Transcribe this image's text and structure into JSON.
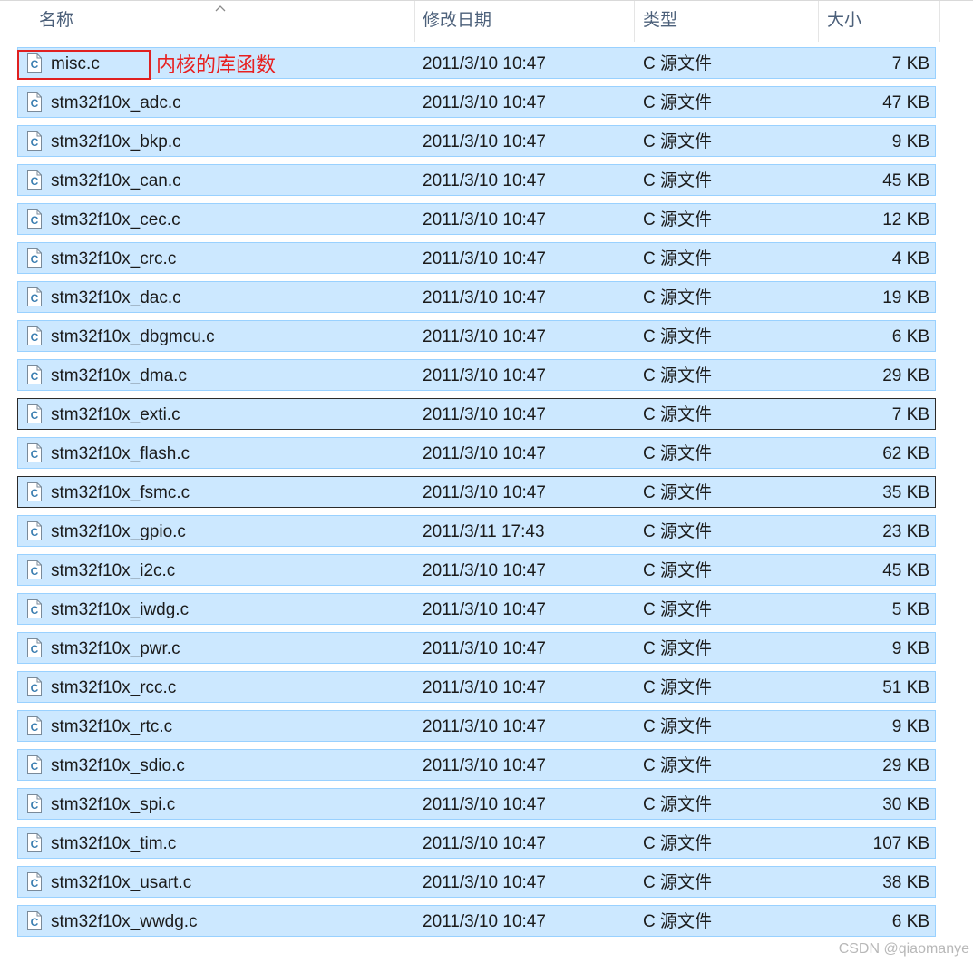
{
  "columns": {
    "name": "名称",
    "date": "修改日期",
    "type": "类型",
    "size": "大小"
  },
  "annotation": "内核的库函数",
  "watermark": "CSDN @qiaomanye",
  "icons": {
    "file": "c-source-file-icon",
    "sort": "sort-ascending-icon"
  },
  "colors": {
    "selection_bg": "#cce8ff",
    "selection_border": "#99d1ff",
    "annotation": "#e82020"
  },
  "files": [
    {
      "name": "misc.c",
      "date": "2011/3/10 10:47",
      "type": "C 源文件",
      "size": "7 KB"
    },
    {
      "name": "stm32f10x_adc.c",
      "date": "2011/3/10 10:47",
      "type": "C 源文件",
      "size": "47 KB"
    },
    {
      "name": "stm32f10x_bkp.c",
      "date": "2011/3/10 10:47",
      "type": "C 源文件",
      "size": "9 KB"
    },
    {
      "name": "stm32f10x_can.c",
      "date": "2011/3/10 10:47",
      "type": "C 源文件",
      "size": "45 KB"
    },
    {
      "name": "stm32f10x_cec.c",
      "date": "2011/3/10 10:47",
      "type": "C 源文件",
      "size": "12 KB"
    },
    {
      "name": "stm32f10x_crc.c",
      "date": "2011/3/10 10:47",
      "type": "C 源文件",
      "size": "4 KB"
    },
    {
      "name": "stm32f10x_dac.c",
      "date": "2011/3/10 10:47",
      "type": "C 源文件",
      "size": "19 KB"
    },
    {
      "name": "stm32f10x_dbgmcu.c",
      "date": "2011/3/10 10:47",
      "type": "C 源文件",
      "size": "6 KB"
    },
    {
      "name": "stm32f10x_dma.c",
      "date": "2011/3/10 10:47",
      "type": "C 源文件",
      "size": "29 KB"
    },
    {
      "name": "stm32f10x_exti.c",
      "date": "2011/3/10 10:47",
      "type": "C 源文件",
      "size": "7 KB",
      "focused": true
    },
    {
      "name": "stm32f10x_flash.c",
      "date": "2011/3/10 10:47",
      "type": "C 源文件",
      "size": "62 KB"
    },
    {
      "name": "stm32f10x_fsmc.c",
      "date": "2011/3/10 10:47",
      "type": "C 源文件",
      "size": "35 KB",
      "focused": true
    },
    {
      "name": "stm32f10x_gpio.c",
      "date": "2011/3/11 17:43",
      "type": "C 源文件",
      "size": "23 KB"
    },
    {
      "name": "stm32f10x_i2c.c",
      "date": "2011/3/10 10:47",
      "type": "C 源文件",
      "size": "45 KB"
    },
    {
      "name": "stm32f10x_iwdg.c",
      "date": "2011/3/10 10:47",
      "type": "C 源文件",
      "size": "5 KB"
    },
    {
      "name": "stm32f10x_pwr.c",
      "date": "2011/3/10 10:47",
      "type": "C 源文件",
      "size": "9 KB"
    },
    {
      "name": "stm32f10x_rcc.c",
      "date": "2011/3/10 10:47",
      "type": "C 源文件",
      "size": "51 KB"
    },
    {
      "name": "stm32f10x_rtc.c",
      "date": "2011/3/10 10:47",
      "type": "C 源文件",
      "size": "9 KB"
    },
    {
      "name": "stm32f10x_sdio.c",
      "date": "2011/3/10 10:47",
      "type": "C 源文件",
      "size": "29 KB"
    },
    {
      "name": "stm32f10x_spi.c",
      "date": "2011/3/10 10:47",
      "type": "C 源文件",
      "size": "30 KB"
    },
    {
      "name": "stm32f10x_tim.c",
      "date": "2011/3/10 10:47",
      "type": "C 源文件",
      "size": "107 KB"
    },
    {
      "name": "stm32f10x_usart.c",
      "date": "2011/3/10 10:47",
      "type": "C 源文件",
      "size": "38 KB"
    },
    {
      "name": "stm32f10x_wwdg.c",
      "date": "2011/3/10 10:47",
      "type": "C 源文件",
      "size": "6 KB"
    }
  ]
}
